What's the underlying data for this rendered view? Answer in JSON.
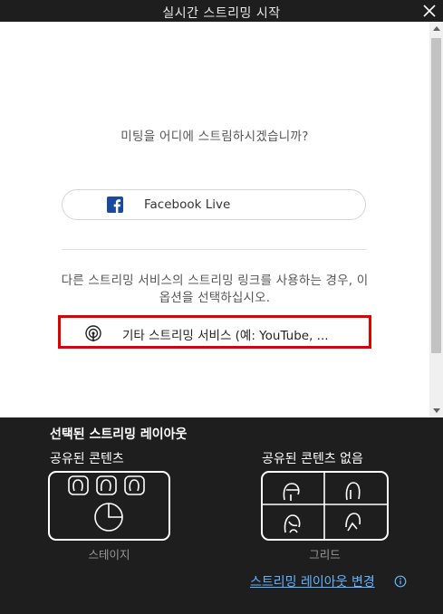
{
  "window": {
    "title": "실시간 스트리밍 시작",
    "close_icon": "close-icon"
  },
  "main": {
    "question": "미팅을 어디에 스트림하시겠습니까?",
    "facebook_button": {
      "label": "Facebook Live",
      "icon": "facebook-icon",
      "icon_color": "#1a4a9c"
    },
    "other_description": "다른 스트리밍 서비스의 스트리밍 링크를 사용하는 경우, 이 옵션을 선택하십시오.",
    "other_button": {
      "label": "기타 스트리밍 서비스 (예: YouTube, ...",
      "icon": "streaming-icon",
      "highlight_color": "#e00000"
    }
  },
  "layout_panel": {
    "heading": "선택된 스트리밍 레이아웃",
    "shared_title": "공유된 콘텐츠",
    "shared_caption": "스테이지",
    "not_shared_title": "공유된 콘텐츠 없음",
    "not_shared_caption": "그리드",
    "change_link": "스트리밍 레이아웃 변경",
    "link_color": "#63b3ff"
  }
}
